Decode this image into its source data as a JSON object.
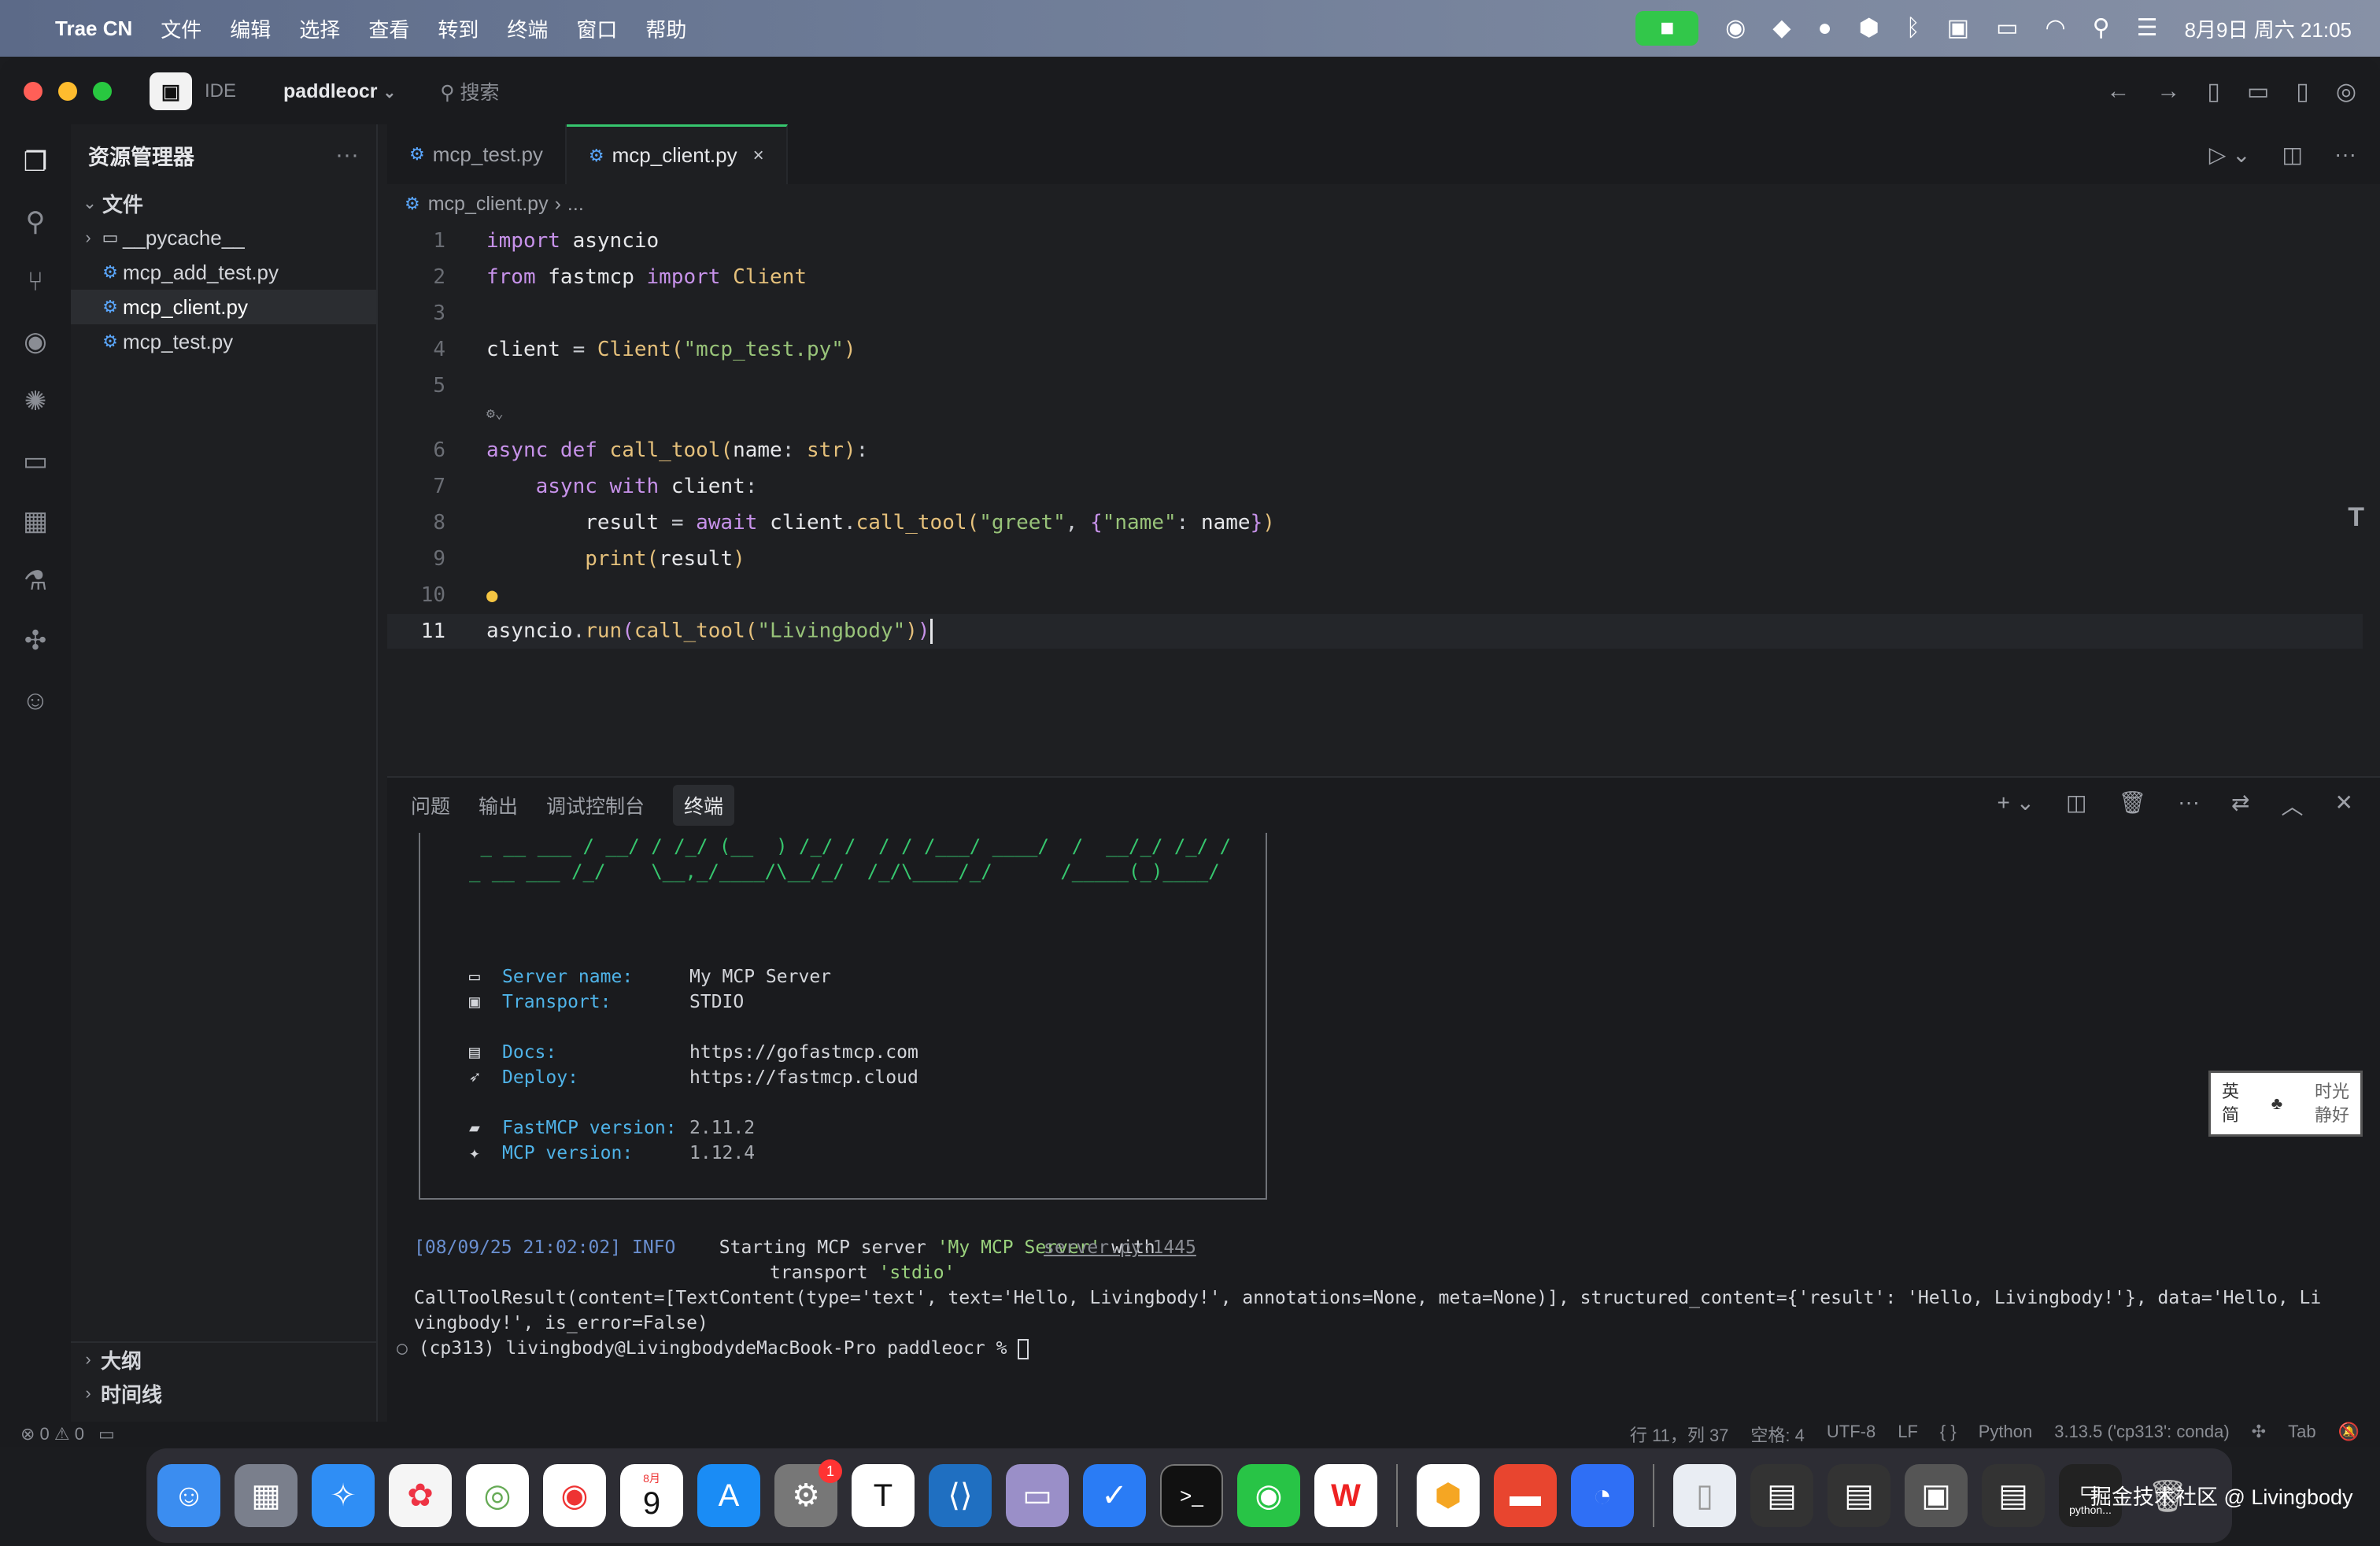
{
  "menubar": {
    "app": "Trae CN",
    "items": [
      "文件",
      "编辑",
      "选择",
      "查看",
      "转到",
      "终端",
      "窗口",
      "帮助"
    ],
    "datetime": "8月9日 周六 21:05"
  },
  "titlebar": {
    "ide_label": "IDE",
    "project": "paddleocr",
    "search_placeholder": "搜索"
  },
  "sidebar": {
    "title": "资源管理器",
    "section": "文件",
    "items": [
      "__pycache__",
      "mcp_add_test.py",
      "mcp_client.py",
      "mcp_test.py"
    ],
    "outline": "大纲",
    "timeline": "时间线"
  },
  "editor": {
    "tabs": [
      "mcp_test.py",
      "mcp_client.py"
    ],
    "breadcrumb": "mcp_client.py",
    "breadcrumb_more": "...",
    "line_numbers": [
      "1",
      "2",
      "3",
      "4",
      "5",
      "6",
      "7",
      "8",
      "9",
      "10",
      "11"
    ]
  },
  "panel": {
    "tabs": [
      "问题",
      "输出",
      "调试控制台",
      "终端"
    ],
    "banner_line1": " _ __ ___ / __/ / /_/ (__  ) /_/ /  / / /___/ ____/  /  __/_/ /_/ /",
    "banner_line2": "_ __ ___ /_/    \\__,_/____/\\__/_/  /_/\\____/_/      /_____(_)____/",
    "server_name_label": "Server name:",
    "server_name": "My MCP Server",
    "transport_label": "Transport:",
    "transport": "STDIO",
    "docs_label": "Docs:",
    "docs": "https://gofastmcp.com",
    "deploy_label": "Deploy:",
    "deploy": "https://fastmcp.cloud",
    "fastmcp_version_label": "FastMCP version:",
    "fastmcp_version": "2.11.2",
    "mcp_version_label": "MCP version:",
    "mcp_version": "1.12.4",
    "log_time": "[08/09/25 21:02:02]",
    "log_level": "INFO",
    "log_msg": "Starting MCP server ",
    "log_name": "'My MCP Server'",
    "log_with": " with",
    "log_src": "server.py:1445",
    "log_transport": "transport ",
    "log_stdio": "'stdio'",
    "result_line1": "CallToolResult(content=[TextContent(type='text', text='Hello, Livingbody!', annotations=None, meta=None)], structured_content={'result': 'Hello, Livingbody!'}, data='Hello, Li",
    "result_line2": "vingbody!', is_error=False)",
    "prompt": "(cp313) livingbody@LivingbodydeMacBook-Pro paddleocr % "
  },
  "status": {
    "errors": "0",
    "warnings": "0",
    "position": "行 11，列 37",
    "spaces": "空格: 4",
    "encoding": "UTF-8",
    "eol": "LF",
    "braces": "{ }",
    "language": "Python",
    "interpreter": "3.13.5 ('cp313': conda)",
    "tab": "Tab"
  },
  "ime": {
    "left_top": "英",
    "left_bottom": "简",
    "right_top": "时光",
    "right_bottom": "静好"
  },
  "dock": {
    "calendar_month": "8月",
    "calendar_day": "9",
    "badge": "1",
    "terminal_label": ">_",
    "watermark": "掘金技术社区 @ Livingbody",
    "last_label": "python..."
  },
  "colors": {
    "accent": "#36c66e",
    "keyword": "#c792ea",
    "function": "#e5c07b",
    "string": "#98c379"
  }
}
